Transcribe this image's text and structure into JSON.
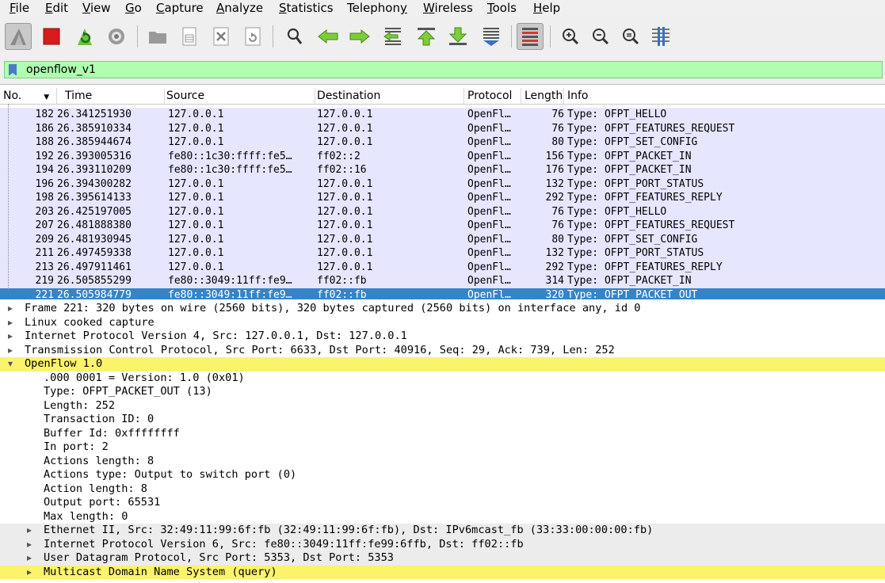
{
  "menu": [
    {
      "pre": "",
      "mn": "F",
      "post": "ile"
    },
    {
      "pre": "",
      "mn": "E",
      "post": "dit"
    },
    {
      "pre": "",
      "mn": "V",
      "post": "iew"
    },
    {
      "pre": "",
      "mn": "G",
      "post": "o"
    },
    {
      "pre": "",
      "mn": "C",
      "post": "apture"
    },
    {
      "pre": "",
      "mn": "A",
      "post": "nalyze"
    },
    {
      "pre": "",
      "mn": "S",
      "post": "tatistics"
    },
    {
      "pre": "Telephon",
      "mn": "y",
      "post": ""
    },
    {
      "pre": "",
      "mn": "W",
      "post": "ireless"
    },
    {
      "pre": "",
      "mn": "T",
      "post": "ools"
    },
    {
      "pre": "",
      "mn": "H",
      "post": "elp"
    }
  ],
  "toolbar": {
    "icons": [
      "shark-fin-icon",
      "stop-capture-icon",
      "restart-capture-icon",
      "capture-options-icon",
      "open-file-icon",
      "save-file-icon",
      "close-file-icon",
      "reload-file-icon",
      "find-packet-icon",
      "go-back-icon",
      "go-forward-icon",
      "go-to-packet-icon",
      "first-packet-icon",
      "last-packet-icon",
      "autoscroll-icon",
      "colorize-icon",
      "zoom-in-icon",
      "zoom-out-icon",
      "normal-size-icon",
      "resize-columns-icon"
    ]
  },
  "filter": {
    "value": "openflow_v1"
  },
  "columns": {
    "no": "No.",
    "time": "Time",
    "source": "Source",
    "destination": "Destination",
    "protocol": "Protocol",
    "length": "Length",
    "info": "Info"
  },
  "packets": [
    {
      "no": "182",
      "time": "26.341251930",
      "src": "127.0.0.1",
      "dst": "127.0.0.1",
      "proto": "OpenFl…",
      "len": "76",
      "info": "Type: OFPT_HELLO"
    },
    {
      "no": "186",
      "time": "26.385910334",
      "src": "127.0.0.1",
      "dst": "127.0.0.1",
      "proto": "OpenFl…",
      "len": "76",
      "info": "Type: OFPT_FEATURES_REQUEST"
    },
    {
      "no": "188",
      "time": "26.385944674",
      "src": "127.0.0.1",
      "dst": "127.0.0.1",
      "proto": "OpenFl…",
      "len": "80",
      "info": "Type: OFPT_SET_CONFIG"
    },
    {
      "no": "192",
      "time": "26.393005316",
      "src": "fe80::1c30:ffff:fe5…",
      "dst": "ff02::2",
      "proto": "OpenFl…",
      "len": "156",
      "info": "Type: OFPT_PACKET_IN"
    },
    {
      "no": "194",
      "time": "26.393110209",
      "src": "fe80::1c30:ffff:fe5…",
      "dst": "ff02::16",
      "proto": "OpenFl…",
      "len": "176",
      "info": "Type: OFPT_PACKET_IN"
    },
    {
      "no": "196",
      "time": "26.394300282",
      "src": "127.0.0.1",
      "dst": "127.0.0.1",
      "proto": "OpenFl…",
      "len": "132",
      "info": "Type: OFPT_PORT_STATUS"
    },
    {
      "no": "198",
      "time": "26.395614133",
      "src": "127.0.0.1",
      "dst": "127.0.0.1",
      "proto": "OpenFl…",
      "len": "292",
      "info": "Type: OFPT_FEATURES_REPLY"
    },
    {
      "no": "203",
      "time": "26.425197005",
      "src": "127.0.0.1",
      "dst": "127.0.0.1",
      "proto": "OpenFl…",
      "len": "76",
      "info": "Type: OFPT_HELLO"
    },
    {
      "no": "207",
      "time": "26.481888380",
      "src": "127.0.0.1",
      "dst": "127.0.0.1",
      "proto": "OpenFl…",
      "len": "76",
      "info": "Type: OFPT_FEATURES_REQUEST"
    },
    {
      "no": "209",
      "time": "26.481930945",
      "src": "127.0.0.1",
      "dst": "127.0.0.1",
      "proto": "OpenFl…",
      "len": "80",
      "info": "Type: OFPT_SET_CONFIG"
    },
    {
      "no": "211",
      "time": "26.497459338",
      "src": "127.0.0.1",
      "dst": "127.0.0.1",
      "proto": "OpenFl…",
      "len": "132",
      "info": "Type: OFPT_PORT_STATUS"
    },
    {
      "no": "213",
      "time": "26.497911461",
      "src": "127.0.0.1",
      "dst": "127.0.0.1",
      "proto": "OpenFl…",
      "len": "292",
      "info": "Type: OFPT_FEATURES_REPLY"
    },
    {
      "no": "219",
      "time": "26.505855299",
      "src": "fe80::3049:11ff:fe9…",
      "dst": "ff02::fb",
      "proto": "OpenFl…",
      "len": "314",
      "info": "Type: OFPT_PACKET_IN"
    },
    {
      "no": "221",
      "time": "26.505984779",
      "src": "fe80::3049:11ff:fe9…",
      "dst": "ff02::fb",
      "proto": "OpenFl…",
      "len": "320",
      "info": "Type: OFPT_PACKET_OUT"
    }
  ],
  "details": [
    {
      "text": "Frame 221: 320 bytes on wire (2560 bits), 320 bytes captured (2560 bits) on interface any, id 0",
      "expander": "collapsed",
      "indent": 0,
      "highlight": "none"
    },
    {
      "text": "Linux cooked capture",
      "expander": "collapsed",
      "indent": 0,
      "highlight": "none"
    },
    {
      "text": "Internet Protocol Version 4, Src: 127.0.0.1, Dst: 127.0.0.1",
      "expander": "collapsed",
      "indent": 0,
      "highlight": "none"
    },
    {
      "text": "Transmission Control Protocol, Src Port: 6633, Dst Port: 40916, Seq: 29, Ack: 739, Len: 252",
      "expander": "collapsed",
      "indent": 0,
      "highlight": "none"
    },
    {
      "text": "OpenFlow 1.0",
      "expander": "expanded",
      "indent": 0,
      "highlight": "row"
    },
    {
      "text": ".000 0001 = Version: 1.0 (0x01)",
      "expander": "none",
      "indent": 1,
      "highlight": "none"
    },
    {
      "text": "Type: OFPT_PACKET_OUT (13)",
      "expander": "none",
      "indent": 1,
      "highlight": "none"
    },
    {
      "text": "Length: 252",
      "expander": "none",
      "indent": 1,
      "highlight": "none"
    },
    {
      "text": "Transaction ID: 0",
      "expander": "none",
      "indent": 1,
      "highlight": "none"
    },
    {
      "text": "Buffer Id: 0xffffffff",
      "expander": "none",
      "indent": 1,
      "highlight": "none"
    },
    {
      "text": "In port: 2",
      "expander": "none",
      "indent": 1,
      "highlight": "none"
    },
    {
      "text": "Actions length: 8",
      "expander": "none",
      "indent": 1,
      "highlight": "none"
    },
    {
      "text": "Actions type: Output to switch port (0)",
      "expander": "none",
      "indent": 1,
      "highlight": "none"
    },
    {
      "text": "Action length: 8",
      "expander": "none",
      "indent": 1,
      "highlight": "none"
    },
    {
      "text": "Output port: 65531",
      "expander": "none",
      "indent": 1,
      "highlight": "none"
    },
    {
      "text": "Max length: 0",
      "expander": "none",
      "indent": 1,
      "highlight": "none"
    },
    {
      "text": "Ethernet II, Src: 32:49:11:99:6f:fb (32:49:11:99:6f:fb), Dst: IPv6mcast_fb (33:33:00:00:00:fb)",
      "expander": "collapsed",
      "indent": 1,
      "highlight": "gray"
    },
    {
      "text": "Internet Protocol Version 6, Src: fe80::3049:11ff:fe99:6ffb, Dst: ff02::fb",
      "expander": "collapsed",
      "indent": 1,
      "highlight": "gray"
    },
    {
      "text": "User Datagram Protocol, Src Port: 5353, Dst Port: 5353",
      "expander": "collapsed",
      "indent": 1,
      "highlight": "gray"
    },
    {
      "text": "Multicast Domain Name System (query)",
      "expander": "collapsed",
      "indent": 1,
      "highlight": "row"
    }
  ],
  "colors": {
    "selected_row": "#3584c8",
    "packet_bg": "#e7e6ff",
    "filter_ok": "#afffaf",
    "highlight": "#fbf36b"
  }
}
